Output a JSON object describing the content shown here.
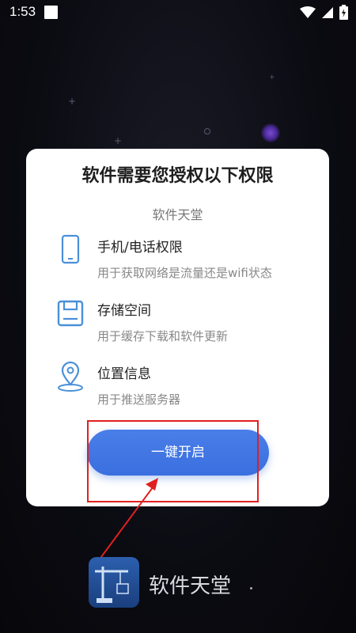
{
  "status_bar": {
    "time": "1:53"
  },
  "dialog": {
    "title": "软件需要您授权以下权限",
    "subtitle": "软件天堂",
    "permissions": [
      {
        "name": "手机/电话权限",
        "desc": "用于获取网络是流量还是wifi状态",
        "icon": "phone-icon"
      },
      {
        "name": "存储空间",
        "desc": "用于缓存下载和软件更新",
        "icon": "storage-icon"
      },
      {
        "name": "位置信息",
        "desc": "用于推送服务器",
        "icon": "location-icon"
      }
    ],
    "button_label": "一键开启"
  },
  "bottom": {
    "app_name": "软件天堂"
  },
  "colors": {
    "accent": "#3a6fdf",
    "icon": "#4a90d9",
    "highlight": "#e02020"
  }
}
